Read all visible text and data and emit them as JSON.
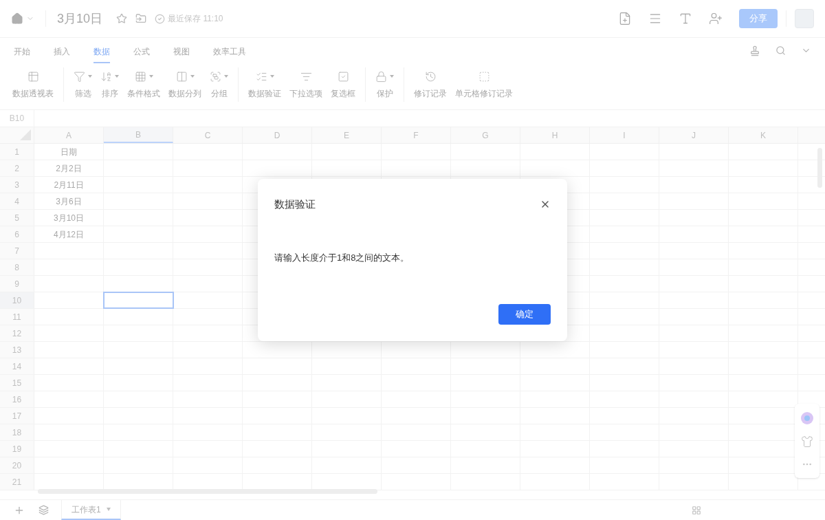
{
  "document": {
    "title": "3月10日",
    "save_status": "最近保存 11:10",
    "share": "分享"
  },
  "tabs": [
    {
      "label": "开始",
      "selected": false
    },
    {
      "label": "插入",
      "selected": false
    },
    {
      "label": "数据",
      "selected": true
    },
    {
      "label": "公式",
      "selected": false
    },
    {
      "label": "视图",
      "selected": false
    },
    {
      "label": "效率工具",
      "selected": false
    }
  ],
  "toolbar": [
    [
      {
        "label": "数据透视表",
        "kind": "pivot",
        "dropdown": false
      }
    ],
    [
      {
        "label": "筛选",
        "kind": "filter",
        "dropdown": true
      },
      {
        "label": "排序",
        "kind": "sort",
        "dropdown": true
      },
      {
        "label": "条件格式",
        "kind": "grid",
        "dropdown": true
      },
      {
        "label": "数据分列",
        "kind": "split",
        "dropdown": true
      },
      {
        "label": "分组",
        "kind": "group",
        "dropdown": true
      }
    ],
    [
      {
        "label": "数据验证",
        "kind": "validate",
        "dropdown": true
      },
      {
        "label": "下拉选项",
        "kind": "list",
        "dropdown": false
      },
      {
        "label": "复选框",
        "kind": "check",
        "dropdown": false
      }
    ],
    [
      {
        "label": "保护",
        "kind": "lock",
        "dropdown": true
      }
    ],
    [
      {
        "label": "修订记录",
        "kind": "history",
        "dropdown": false
      },
      {
        "label": "单元格修订记录",
        "kind": "cellhistory",
        "dropdown": false
      }
    ]
  ],
  "name_box": "B10",
  "columns": [
    {
      "label": "A",
      "selected": false
    },
    {
      "label": "B",
      "selected": true
    },
    {
      "label": "C",
      "selected": false
    },
    {
      "label": "D",
      "selected": false
    },
    {
      "label": "E",
      "selected": false
    },
    {
      "label": "F",
      "selected": false
    },
    {
      "label": "G",
      "selected": false
    },
    {
      "label": "H",
      "selected": false
    },
    {
      "label": "I",
      "selected": false
    },
    {
      "label": "J",
      "selected": false
    },
    {
      "label": "K",
      "selected": false
    }
  ],
  "rows": [
    {
      "label": "1",
      "selected": false,
      "cells": [
        "日期"
      ]
    },
    {
      "label": "2",
      "selected": false,
      "cells": [
        "2月2日"
      ]
    },
    {
      "label": "3",
      "selected": false,
      "cells": [
        "2月11日"
      ]
    },
    {
      "label": "4",
      "selected": false,
      "cells": [
        "3月6日"
      ]
    },
    {
      "label": "5",
      "selected": false,
      "cells": [
        "3月10日"
      ]
    },
    {
      "label": "6",
      "selected": false,
      "cells": [
        "4月12日"
      ]
    },
    {
      "label": "7",
      "selected": false,
      "cells": []
    },
    {
      "label": "8",
      "selected": false,
      "cells": []
    },
    {
      "label": "9",
      "selected": false,
      "cells": []
    },
    {
      "label": "10",
      "selected": true,
      "cells": []
    },
    {
      "label": "11",
      "selected": false,
      "cells": []
    },
    {
      "label": "12",
      "selected": false,
      "cells": []
    },
    {
      "label": "13",
      "selected": false,
      "cells": []
    },
    {
      "label": "14",
      "selected": false,
      "cells": []
    },
    {
      "label": "15",
      "selected": false,
      "cells": []
    },
    {
      "label": "16",
      "selected": false,
      "cells": []
    },
    {
      "label": "17",
      "selected": false,
      "cells": []
    },
    {
      "label": "18",
      "selected": false,
      "cells": []
    },
    {
      "label": "19",
      "selected": false,
      "cells": []
    },
    {
      "label": "20",
      "selected": false,
      "cells": []
    },
    {
      "label": "21",
      "selected": false,
      "cells": []
    }
  ],
  "sheets": [
    {
      "label": "工作表1",
      "selected": true
    }
  ],
  "dialog": {
    "title": "数据验证",
    "message": "请输入长度介于1和8之间的文本。",
    "button": "确定"
  }
}
